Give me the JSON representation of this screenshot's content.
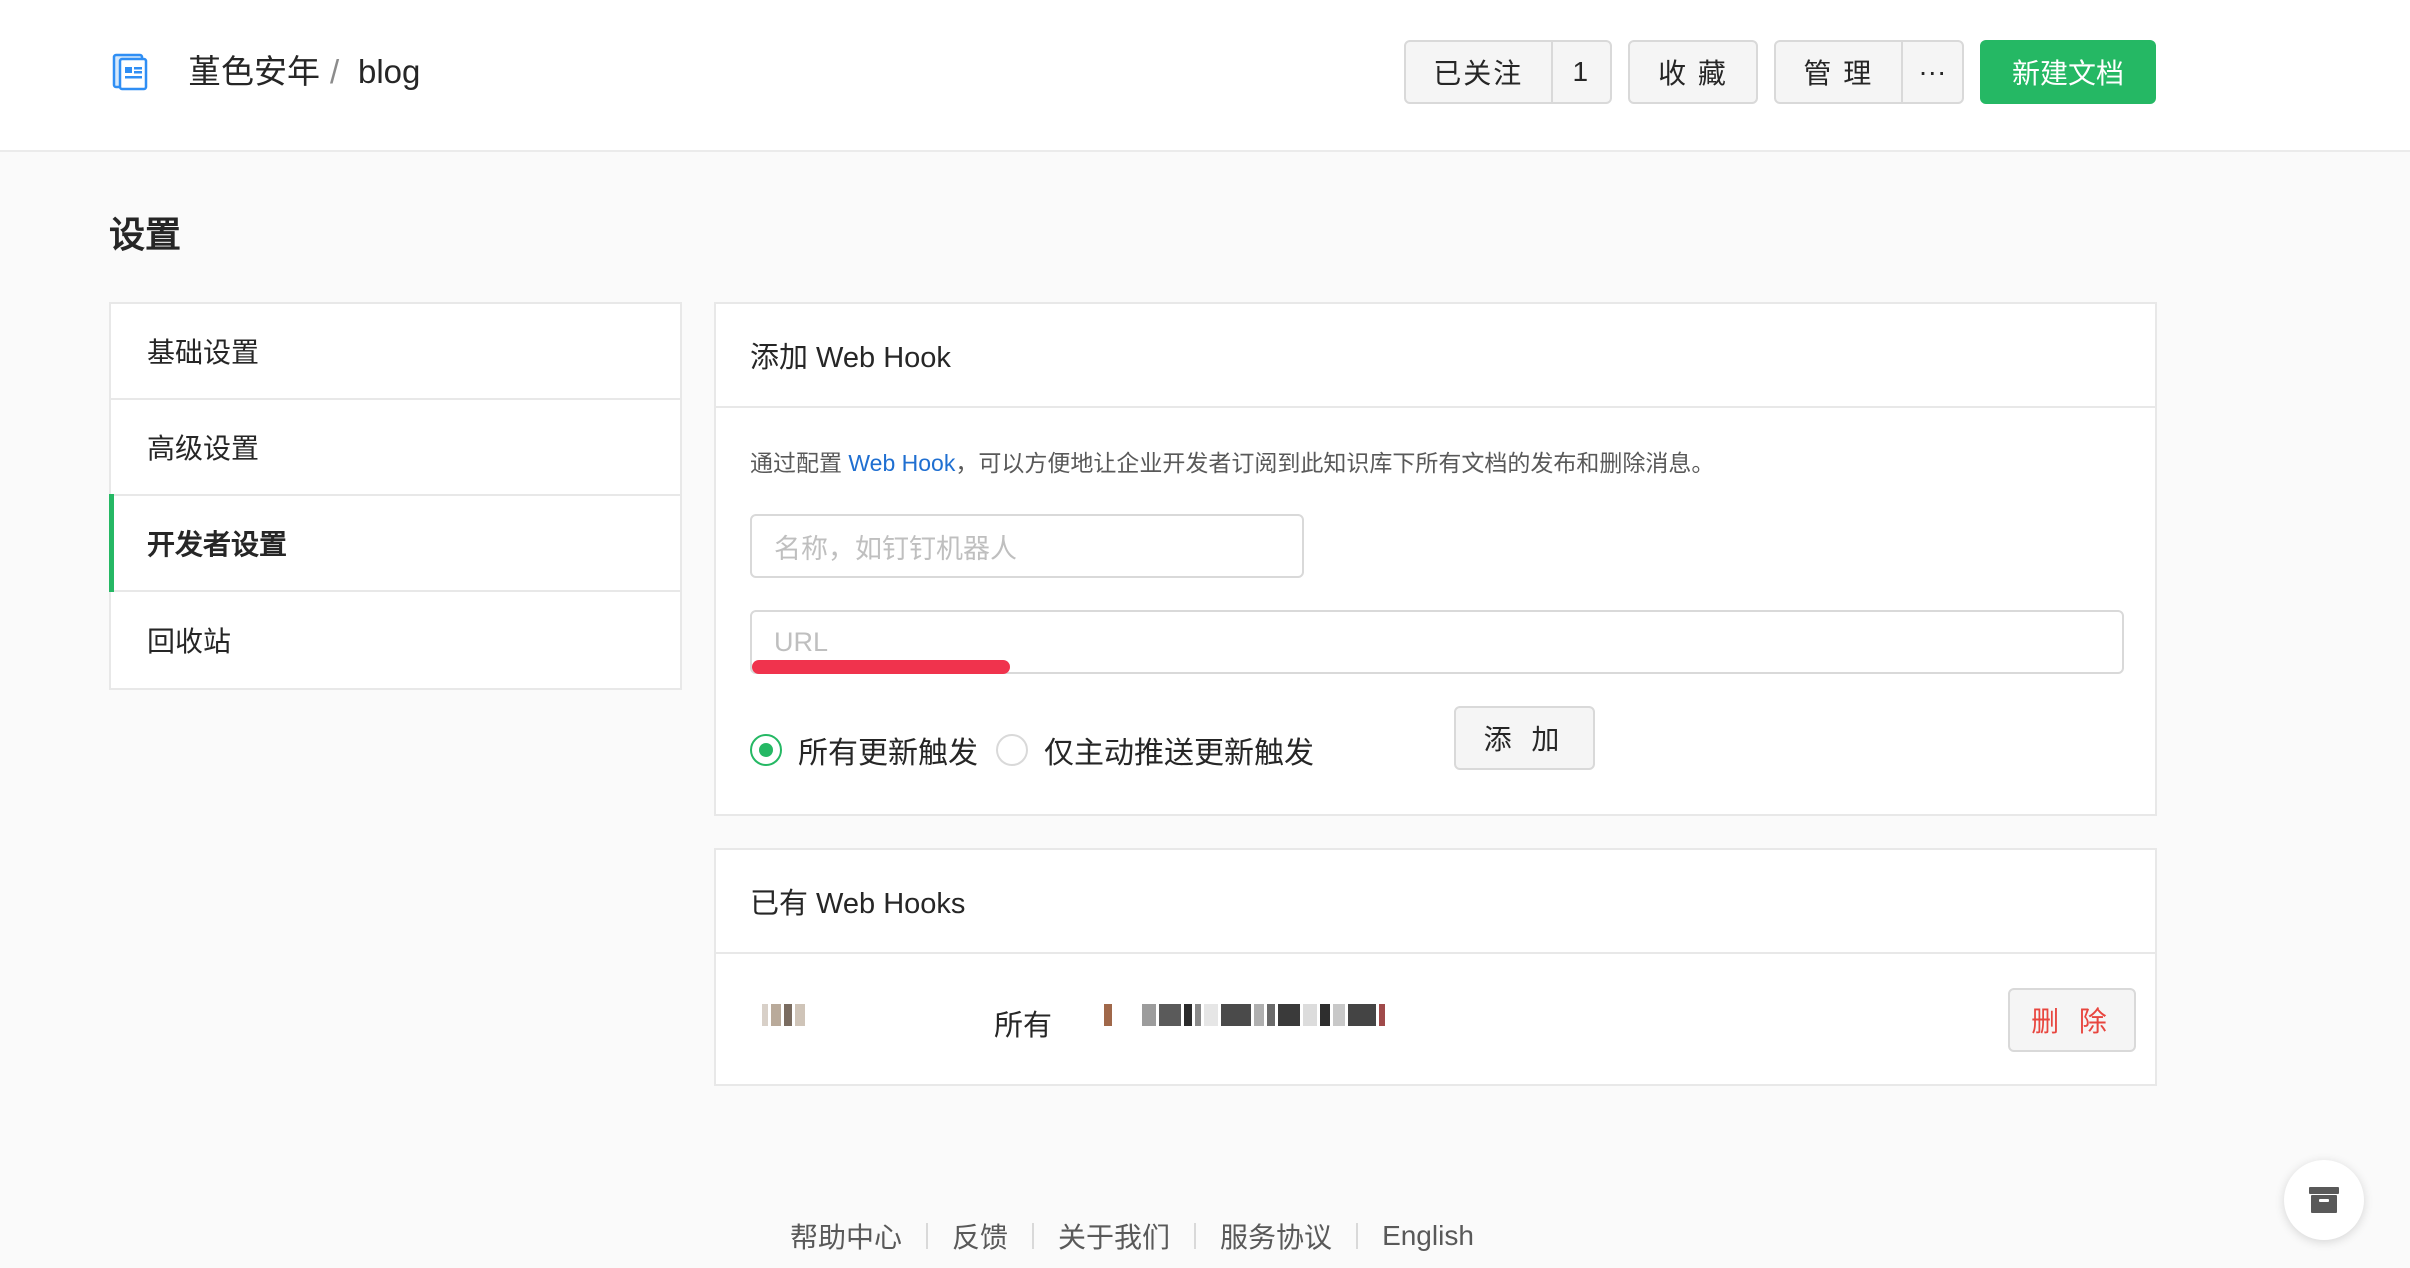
{
  "header": {
    "breadcrumb": {
      "owner": "堇色安年",
      "separator": "/",
      "repo": "blog"
    },
    "follow_label": "已关注",
    "follow_count": "1",
    "collect_label": "收 藏",
    "manage_label": "管 理",
    "more_label": "···",
    "new_doc_label": "新建文档"
  },
  "page": {
    "title": "设置"
  },
  "sidebar": {
    "items": [
      {
        "label": "基础设置"
      },
      {
        "label": "高级设置"
      },
      {
        "label": "开发者设置"
      },
      {
        "label": "回收站"
      }
    ],
    "active_index": 2
  },
  "add_webhook": {
    "title": "添加 Web Hook",
    "desc_prefix": "通过配置 ",
    "desc_link": "Web Hook",
    "desc_suffix": "，可以方便地让企业开发者订阅到此知识库下所有文档的发布和删除消息。",
    "name_placeholder": "名称，如钉钉机器人",
    "url_placeholder": "URL",
    "radio_all": "所有更新触发",
    "radio_push": "仅主动推送更新触发",
    "add_label": "添 加"
  },
  "existing_webhooks": {
    "title": "已有 Web Hooks",
    "rows": [
      {
        "type": "所有",
        "delete_label": "删 除"
      }
    ]
  },
  "footer": {
    "links": [
      "帮助中心",
      "反馈",
      "关于我们",
      "服务协议",
      "English"
    ]
  },
  "colors": {
    "primary_green": "#25b864",
    "link_blue": "#1f6fd1",
    "delete_red": "#e8463f",
    "annotation_red": "#f0334d"
  },
  "icons": {
    "logo": "book-icon",
    "float": "archive-icon"
  }
}
